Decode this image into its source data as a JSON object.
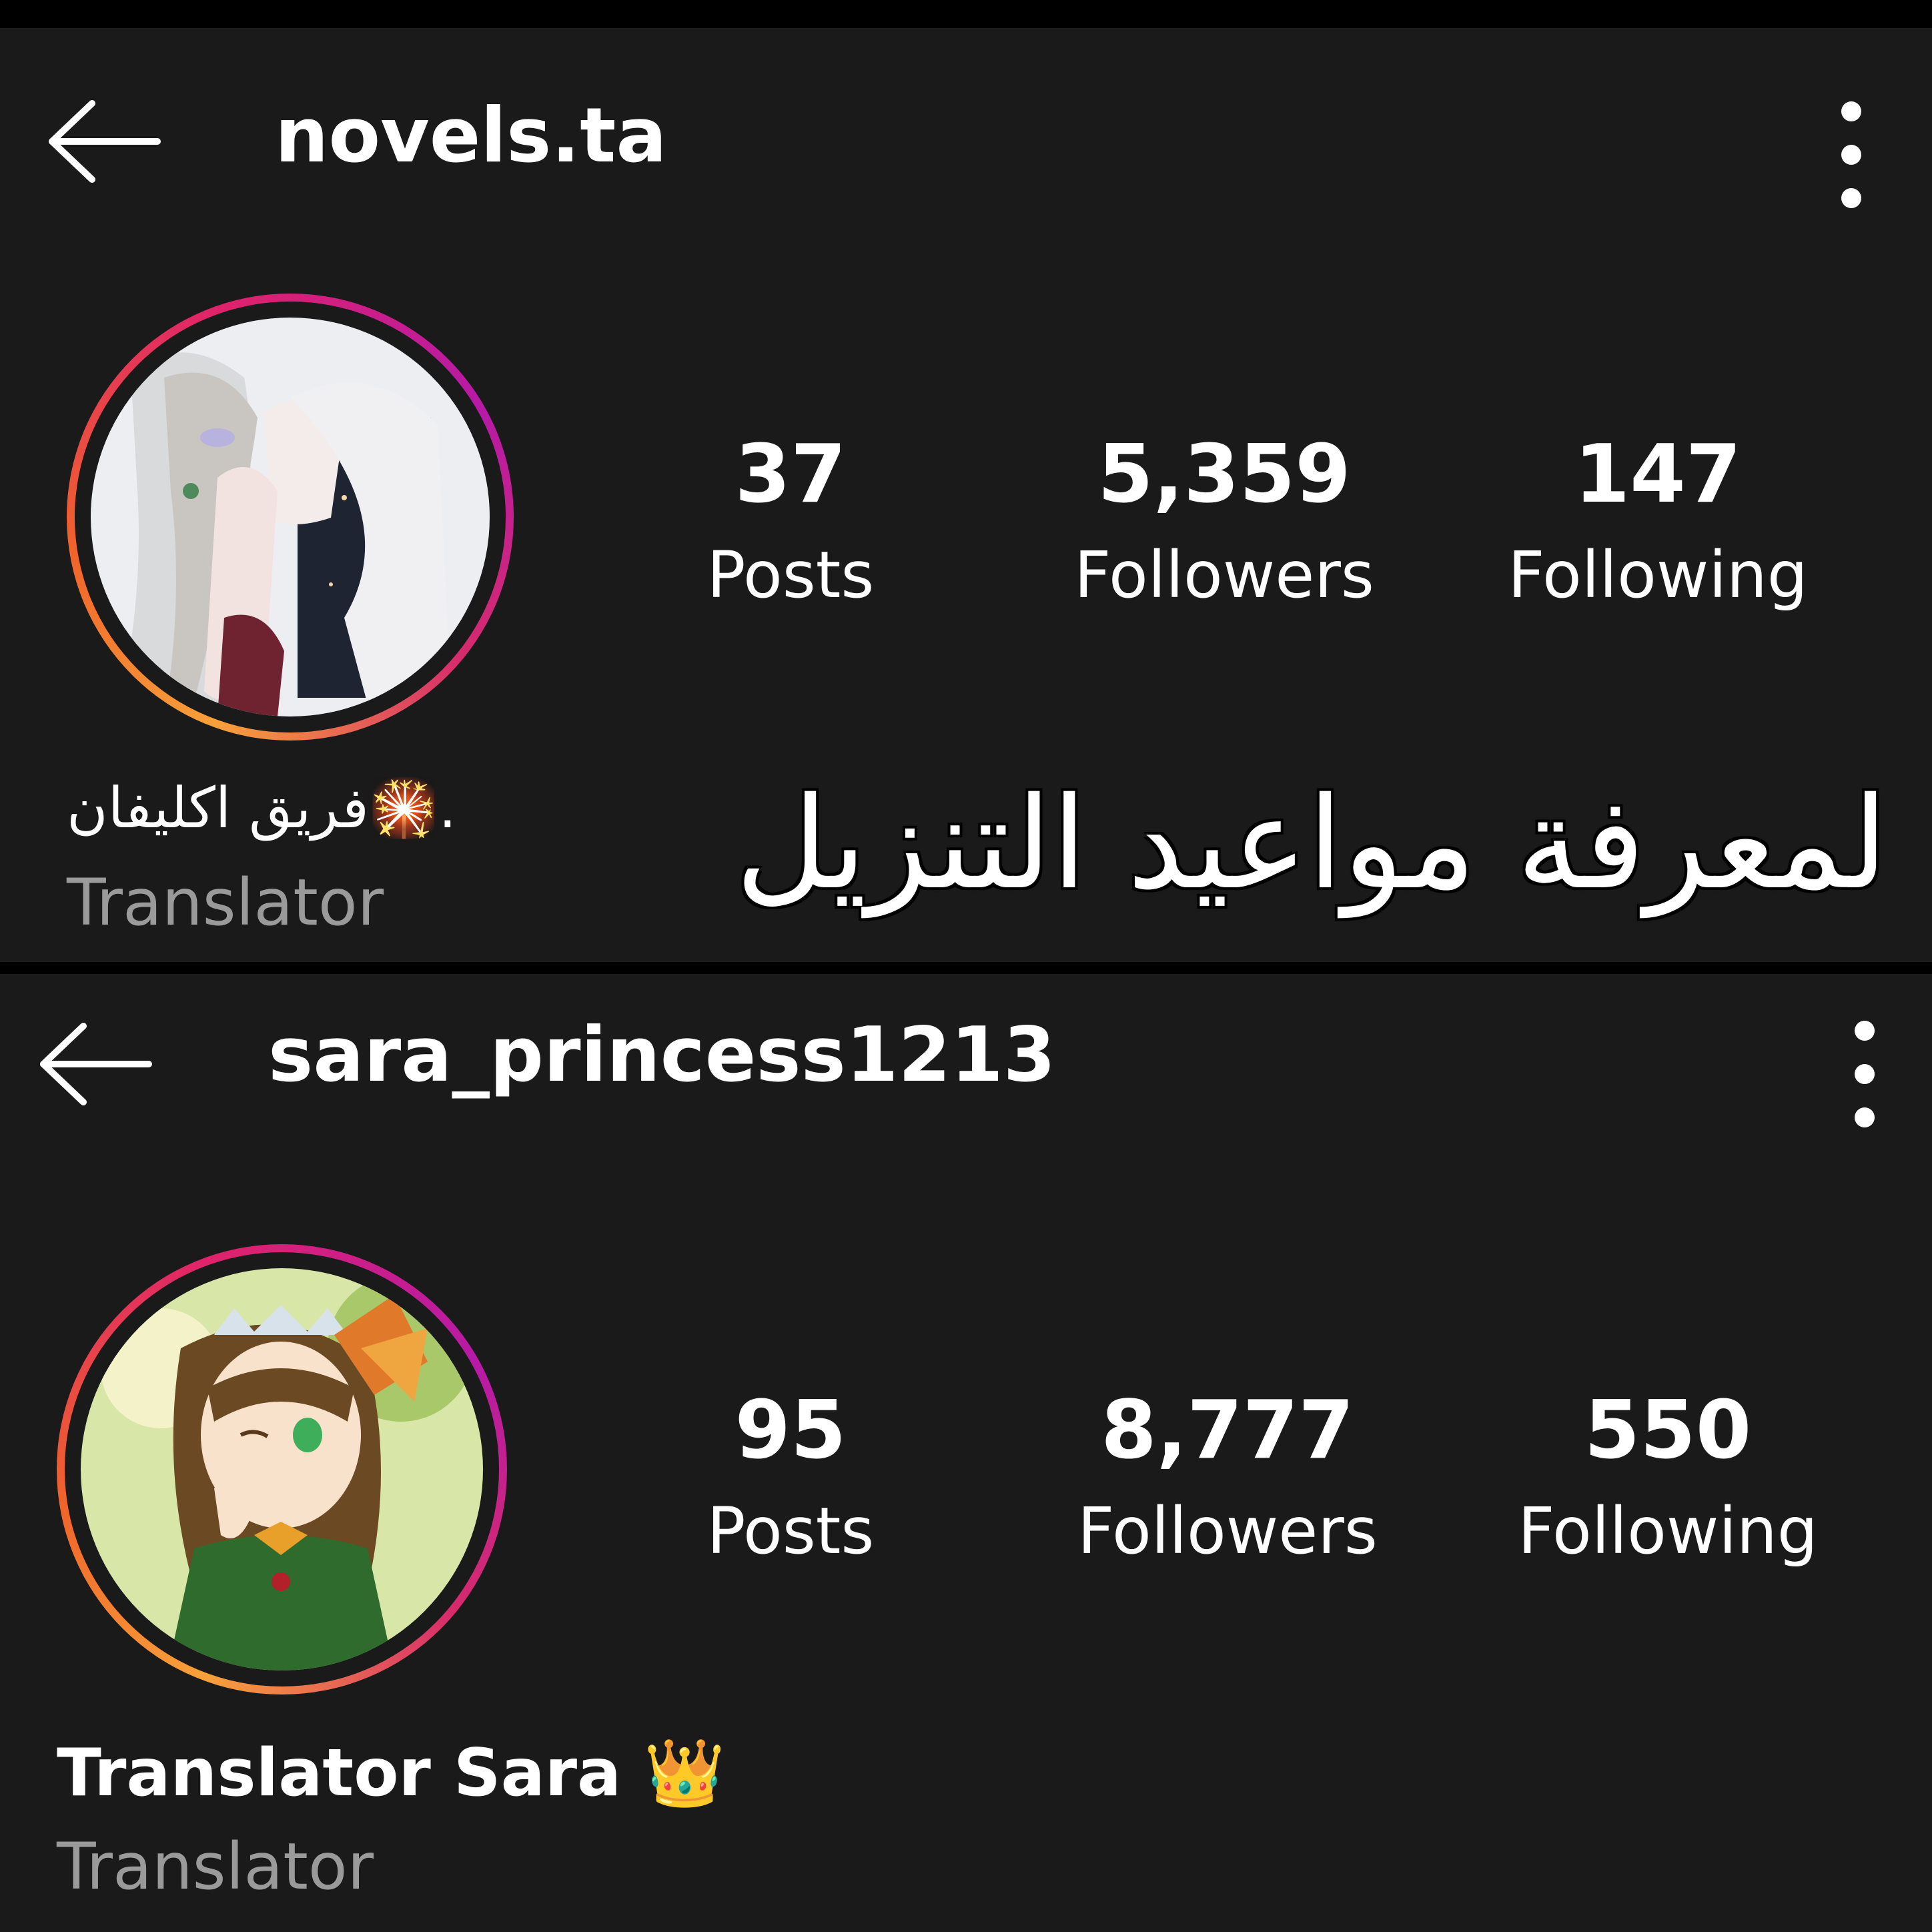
{
  "profiles": [
    {
      "username": "novels.ta",
      "stats": [
        {
          "value": "37",
          "label": "Posts"
        },
        {
          "value": "5,359",
          "label": "Followers"
        },
        {
          "value": "147",
          "label": "Following"
        }
      ],
      "bio_name": ".🎇فريق اكليفان",
      "category": "Translator"
    },
    {
      "username": "sara_princess1213",
      "stats": [
        {
          "value": "95",
          "label": "Posts"
        },
        {
          "value": "8,777",
          "label": "Followers"
        },
        {
          "value": "550",
          "label": "Following"
        }
      ],
      "bio_name": "Translator Sara 👑",
      "category": "Translator"
    }
  ],
  "overlay_text": "لمعرفة مواعيد التنزيل",
  "icons": {
    "back": "back-arrow-icon",
    "menu": "more-vertical-icon"
  },
  "colors": {
    "background": "#1a1a1a",
    "ring_start": "#f7a13a",
    "ring_end": "#b61aa7"
  }
}
